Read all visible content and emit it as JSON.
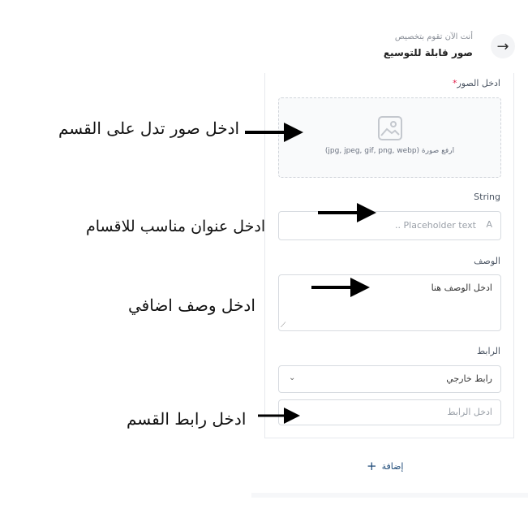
{
  "header": {
    "subtitle": "أنت الآن تقوم بتخصيص",
    "title": "صور قابلة للتوسيع",
    "back_icon": "arrow-right-icon"
  },
  "form": {
    "images_label": "ادخل الصور",
    "required_mark": "*",
    "upload_hint": "ارفع صورة (jpg, jpeg, gif, png, webp)",
    "string_label": "String",
    "string_placeholder": "Placeholder text ..",
    "description_label": "الوصف",
    "description_value": "ادخل الوصف هنا",
    "link_label": "الرابط",
    "link_type_value": "رابط خارجي",
    "link_placeholder": "ادخل الرابط",
    "add_label": "إضافة"
  },
  "annotations": {
    "images_note": "ادخل صور تدل على القسم",
    "title_note": "ادخل عنوان مناسب للاقسام",
    "description_note": "ادخل وصف اضافي",
    "link_note": "ادخل رابط القسم"
  }
}
